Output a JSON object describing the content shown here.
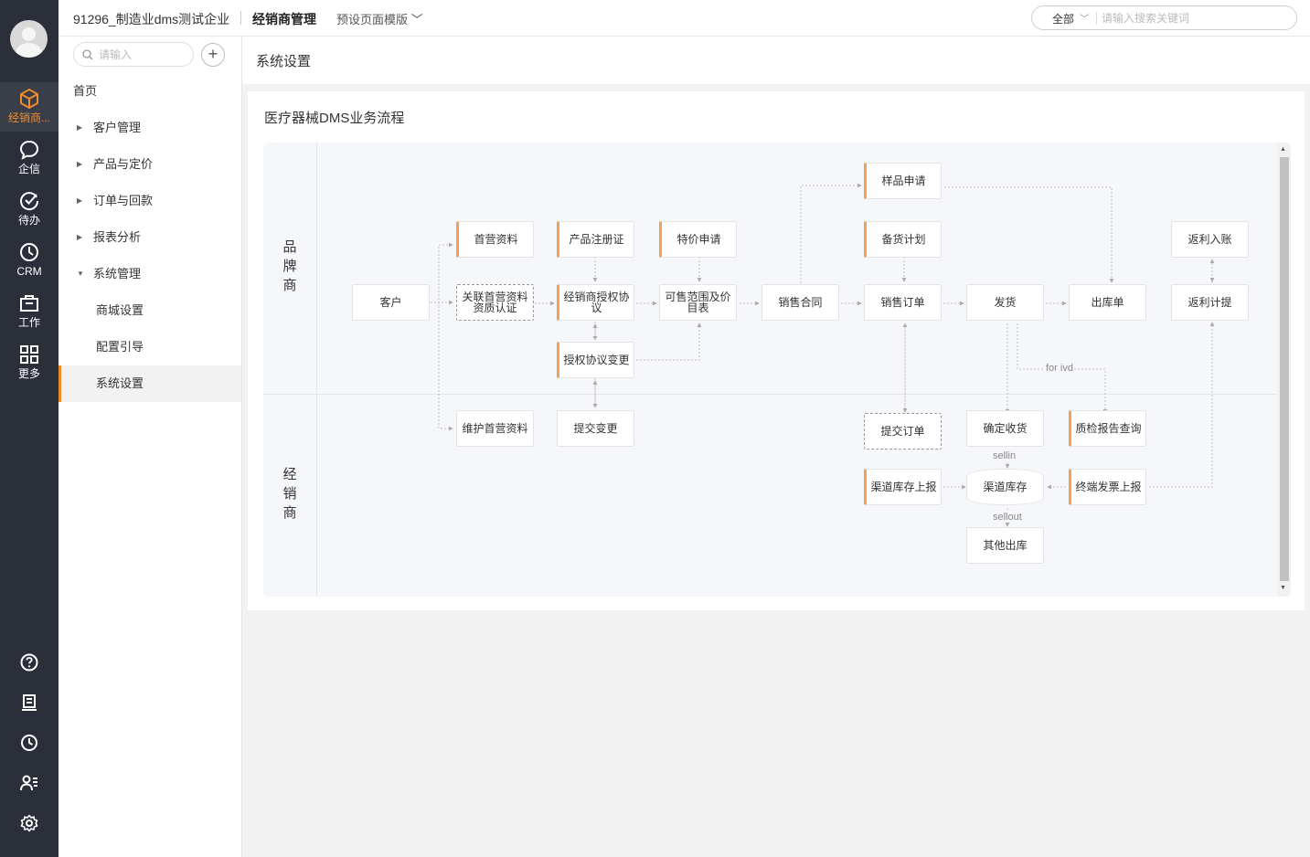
{
  "rail": {
    "items": [
      {
        "label": "经销商...",
        "icon": "cube-icon"
      },
      {
        "label": "企信",
        "icon": "chat-icon"
      },
      {
        "label": "待办",
        "icon": "check-circle-icon"
      },
      {
        "label": "CRM",
        "icon": "clock-icon"
      },
      {
        "label": "工作",
        "icon": "briefcase-icon"
      },
      {
        "label": "更多",
        "icon": "grid-icon"
      }
    ],
    "accent_color": "#f08c2e"
  },
  "topbar": {
    "company": "91296_制造业dms测试企业",
    "module": "经销商管理",
    "preset_template": "预设页面模版",
    "search_scope": "全部",
    "search_placeholder": "请输入搜索关键词"
  },
  "sidenav": {
    "search_placeholder": "请输入",
    "items": [
      {
        "label": "首页"
      },
      {
        "label": "客户管理"
      },
      {
        "label": "产品与定价"
      },
      {
        "label": "订单与回款"
      },
      {
        "label": "报表分析"
      },
      {
        "label": "系统管理"
      },
      {
        "label": "商城设置"
      },
      {
        "label": "配置引导"
      },
      {
        "label": "系统设置"
      }
    ]
  },
  "page": {
    "title": "系统设置",
    "card_title": "医疗器械DMS业务流程"
  },
  "flow": {
    "lanes": [
      {
        "label": "品\n牌\n商"
      },
      {
        "label": "经\n销\n商"
      }
    ],
    "nodes": {
      "customer": "客户",
      "first_data": "首营资料",
      "link_qualification": "关联首营资料资质认证",
      "product_reg": "产品注册证",
      "dealer_auth": "经销商授权协议",
      "auth_change": "授权协议变更",
      "special_price": "特价申请",
      "sale_scope": "可售范围及价目表",
      "sales_contract": "销售合同",
      "sample_apply": "样品申请",
      "stock_plan": "备货计划",
      "sales_order": "销售订单",
      "delivery": "发货",
      "outbound": "出库单",
      "rebate_entry": "返利入账",
      "rebate_accrual": "返利计提",
      "maintain_first": "维护首营资料",
      "submit_change": "提交变更",
      "submit_order": "提交订单",
      "confirm_receipt": "确定收货",
      "qc_report": "质检报告查询",
      "channel_stock_report": "渠道库存上报",
      "channel_stock": "渠道库存",
      "terminal_invoice": "终端发票上报",
      "other_outbound": "其他出库"
    },
    "edge_labels": {
      "for_ivd": "for ivd",
      "sellin": "sellin",
      "sellout": "sellout"
    }
  }
}
